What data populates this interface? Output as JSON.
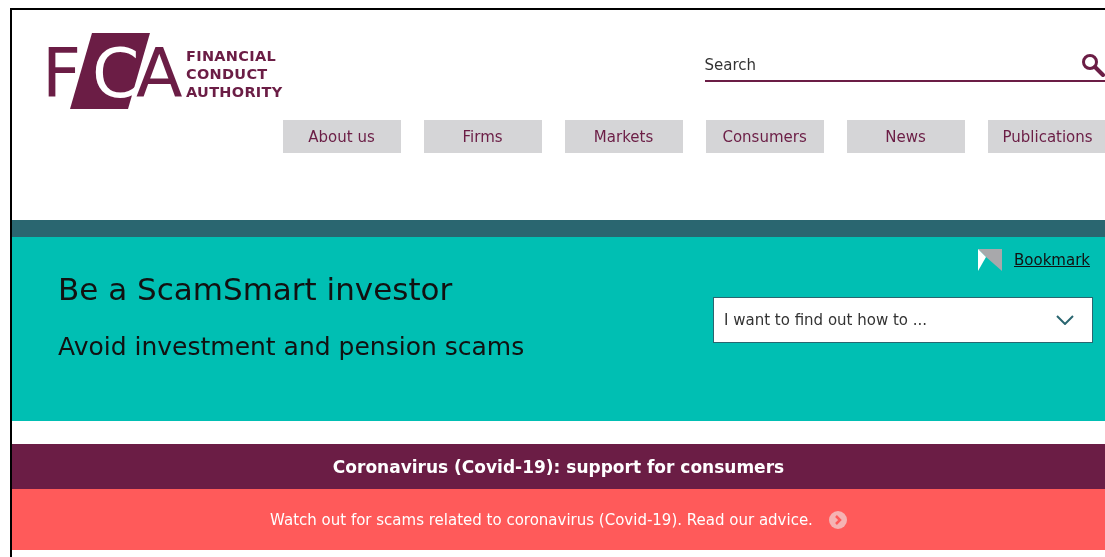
{
  "logo": {
    "mark": "FCA",
    "name_lines": [
      "FINANCIAL",
      "CONDUCT",
      "AUTHORITY"
    ]
  },
  "search": {
    "placeholder": "Search"
  },
  "nav": [
    {
      "label": "About us"
    },
    {
      "label": "Firms"
    },
    {
      "label": "Markets"
    },
    {
      "label": "Consumers"
    },
    {
      "label": "News"
    },
    {
      "label": "Publications"
    }
  ],
  "hero": {
    "title": "Be a ScamSmart investor",
    "subtitle": "Avoid investment and pension scams",
    "bookmark": "Bookmark",
    "dropdown": {
      "value": "I want to find out how to ..."
    }
  },
  "covid_banner": {
    "title": "Coronavirus (Covid-19): support for consumers"
  },
  "alert": {
    "text": "Watch out for scams related to coronavirus (Covid-19). Read our advice."
  }
}
